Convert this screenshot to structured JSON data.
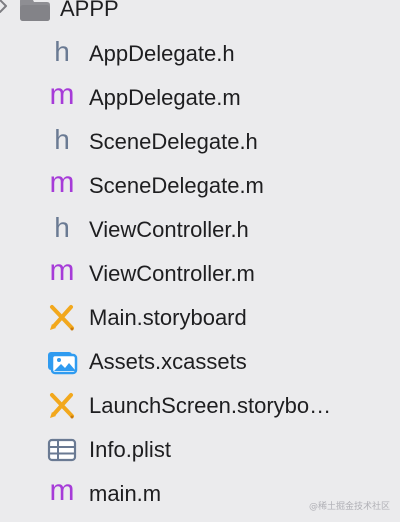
{
  "folder": {
    "name": "APPP",
    "icon": "folder-icon",
    "color": "#8e8e93"
  },
  "files": [
    {
      "name": "AppDelegate.h",
      "icon": "header-file-icon",
      "glyph": "h"
    },
    {
      "name": "AppDelegate.m",
      "icon": "objc-source-file-icon",
      "glyph": "m"
    },
    {
      "name": "SceneDelegate.h",
      "icon": "header-file-icon",
      "glyph": "h"
    },
    {
      "name": "SceneDelegate.m",
      "icon": "objc-source-file-icon",
      "glyph": "m"
    },
    {
      "name": "ViewController.h",
      "icon": "header-file-icon",
      "glyph": "h"
    },
    {
      "name": "ViewController.m",
      "icon": "objc-source-file-icon",
      "glyph": "m"
    },
    {
      "name": "Main.storyboard",
      "icon": "storyboard-icon"
    },
    {
      "name": "Assets.xcassets",
      "icon": "asset-catalog-icon"
    },
    {
      "name": "LaunchScreen.storybo…",
      "icon": "storyboard-icon"
    },
    {
      "name": "Info.plist",
      "icon": "plist-table-icon"
    },
    {
      "name": "main.m",
      "icon": "objc-source-file-icon",
      "glyph": "m"
    }
  ],
  "colors": {
    "background": "#ebebed",
    "header_glyph": "#6a7a93",
    "source_glyph": "#a63bd8",
    "storyboard_accent": "#f2a81d",
    "assets_accent": "#2f9bf0"
  },
  "watermark": "@稀土掘金技术社区"
}
